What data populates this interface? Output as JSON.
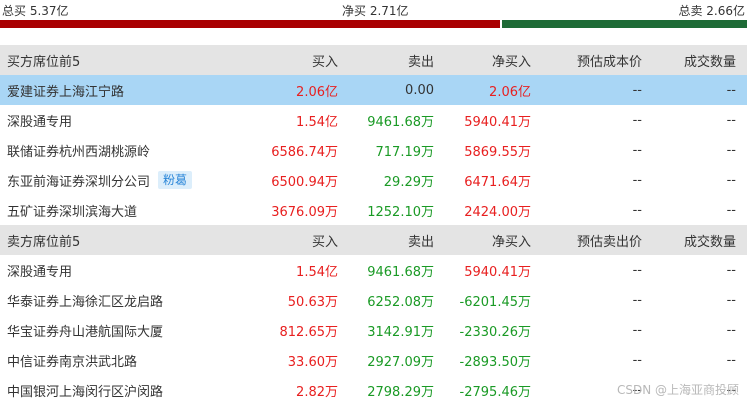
{
  "summary": {
    "total_buy": "总买 5.37亿",
    "net_buy": "净买 2.71亿",
    "total_sell": "总卖 2.66亿",
    "buy_ratio": 0.669,
    "colors": {
      "buy": "#a90002",
      "sell": "#1e6b36"
    }
  },
  "buy_table": {
    "headers": [
      "买方席位前5",
      "买入",
      "卖出",
      "净买入",
      "预估成本价",
      "成交数量"
    ],
    "rows": [
      {
        "name": "爱建证券上海江宁路",
        "tag": "",
        "buy": "2.06亿",
        "sell": "0.00",
        "net": "2.06亿",
        "cost": "--",
        "qty": "--",
        "highlight": true,
        "sell_color": "dark",
        "net_color": "red"
      },
      {
        "name": "深股通专用",
        "tag": "",
        "buy": "1.54亿",
        "sell": "9461.68万",
        "net": "5940.41万",
        "cost": "--",
        "qty": "--",
        "highlight": false,
        "sell_color": "green",
        "net_color": "red"
      },
      {
        "name": "联储证券杭州西湖桃源岭",
        "tag": "",
        "buy": "6586.74万",
        "sell": "717.19万",
        "net": "5869.55万",
        "cost": "--",
        "qty": "--",
        "highlight": false,
        "sell_color": "green",
        "net_color": "red"
      },
      {
        "name": "东亚前海证券深圳分公司",
        "tag": "粉葛",
        "buy": "6500.94万",
        "sell": "29.29万",
        "net": "6471.64万",
        "cost": "--",
        "qty": "--",
        "highlight": false,
        "sell_color": "green",
        "net_color": "red"
      },
      {
        "name": "五矿证券深圳滨海大道",
        "tag": "",
        "buy": "3676.09万",
        "sell": "1252.10万",
        "net": "2424.00万",
        "cost": "--",
        "qty": "--",
        "highlight": false,
        "sell_color": "green",
        "net_color": "red"
      }
    ]
  },
  "sell_table": {
    "headers": [
      "卖方席位前5",
      "买入",
      "卖出",
      "净买入",
      "预估卖出价",
      "成交数量"
    ],
    "rows": [
      {
        "name": "深股通专用",
        "tag": "",
        "buy": "1.54亿",
        "sell": "9461.68万",
        "net": "5940.41万",
        "cost": "--",
        "qty": "--",
        "highlight": false,
        "sell_color": "green",
        "net_color": "red"
      },
      {
        "name": "华泰证券上海徐汇区龙启路",
        "tag": "",
        "buy": "50.63万",
        "sell": "6252.08万",
        "net": "-6201.45万",
        "cost": "--",
        "qty": "--",
        "highlight": false,
        "sell_color": "green",
        "net_color": "green"
      },
      {
        "name": "华宝证券舟山港航国际大厦",
        "tag": "",
        "buy": "812.65万",
        "sell": "3142.91万",
        "net": "-2330.26万",
        "cost": "--",
        "qty": "--",
        "highlight": false,
        "sell_color": "green",
        "net_color": "green"
      },
      {
        "name": "中信证券南京洪武北路",
        "tag": "",
        "buy": "33.60万",
        "sell": "2927.09万",
        "net": "-2893.50万",
        "cost": "--",
        "qty": "--",
        "highlight": false,
        "sell_color": "green",
        "net_color": "green"
      },
      {
        "name": "中国银河上海闵行区沪闵路",
        "tag": "",
        "buy": "2.82万",
        "sell": "2798.29万",
        "net": "-2795.46万",
        "cost": "--",
        "qty": "--",
        "highlight": false,
        "sell_color": "green",
        "net_color": "green"
      }
    ]
  },
  "watermark": "CSDN @上海亚商投顾"
}
